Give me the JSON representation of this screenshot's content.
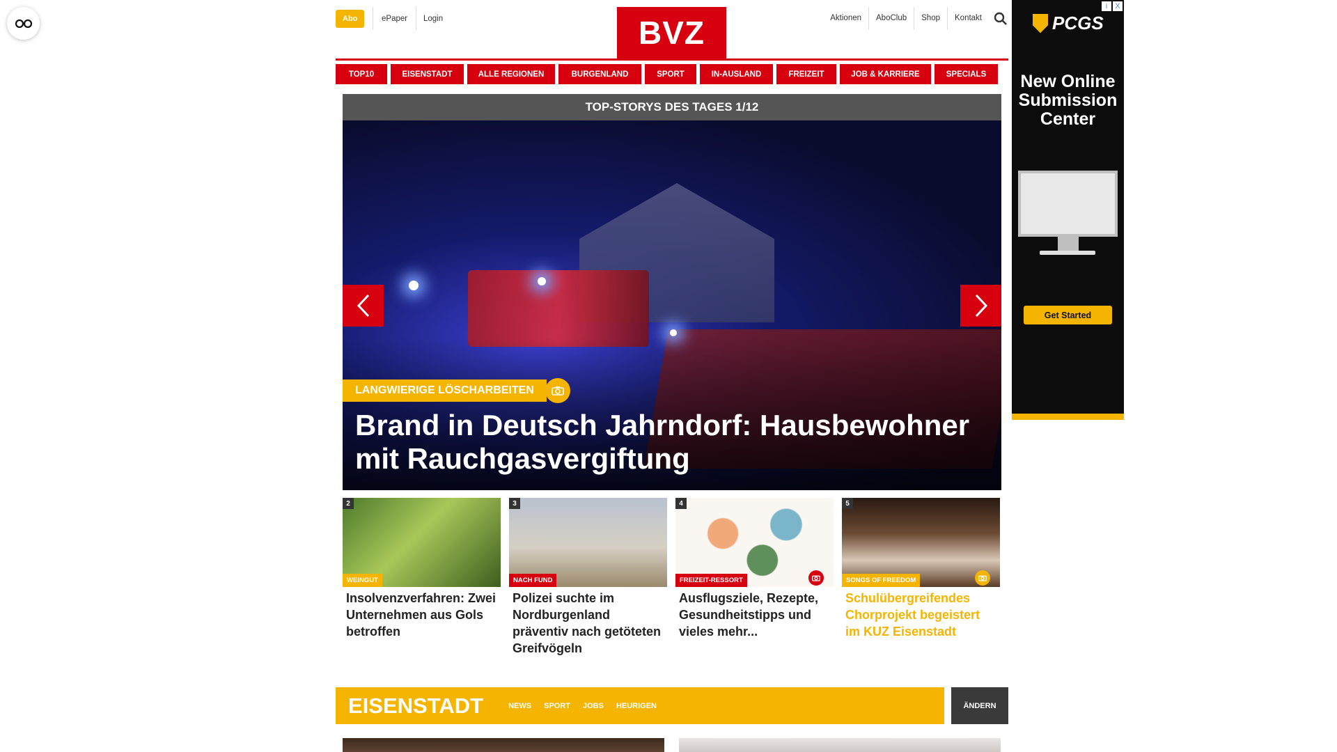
{
  "header": {
    "abo_label": "Abo",
    "epaper_label": "ePaper",
    "login_label": "Login",
    "logo_text": "BVZ",
    "right_links": [
      "Aktionen",
      "AboClub",
      "Shop",
      "Kontakt"
    ]
  },
  "nav": {
    "items": [
      "TOP10",
      "EISENSTADT",
      "ALLE REGIONEN",
      "BURGENLAND",
      "SPORT",
      "IN-AUSLAND",
      "FREIZEIT",
      "JOB & KARRIERE",
      "SPECIALS"
    ]
  },
  "hero": {
    "header": "TOP-STORYS DES TAGES 1/12",
    "kicker": "LANGWIERIGE LÖSCHARBEITEN",
    "title": "Brand in Deutsch Jahrndorf: Hausbewohner mit Rauchgasvergiftung"
  },
  "cards": [
    {
      "num": "2",
      "kicker": "WEINGUT",
      "title": "Insolvenzverfahren: Zwei Unternehmen aus Gols betroffen"
    },
    {
      "num": "3",
      "kicker": "NACH FUND",
      "title": "Polizei suchte im Nordburgenland präventiv nach getöteten Greifvögeln"
    },
    {
      "num": "4",
      "kicker": "FREIZEIT-RESSORT",
      "title": "Ausflugsziele, Rezepte, Gesundheitstipps und vieles mehr..."
    },
    {
      "num": "5",
      "kicker": "SONGS OF FREEDOM",
      "title": "Schulübergreifendes Chorprojekt begeistert im KUZ Eisenstadt"
    }
  ],
  "region": {
    "title": "EISENSTADT",
    "links": [
      "NEWS",
      "SPORT",
      "JOBS",
      "HEURIGEN"
    ],
    "change_label": "ÄNDERN"
  },
  "ad": {
    "brand": "PCGS",
    "headline": "New Online Submission Center",
    "button": "Get Started",
    "close_icons": [
      "i",
      "X"
    ]
  },
  "colors": {
    "brand_red": "#d7000f",
    "accent_yellow": "#f5b400",
    "dark_bar": "#555555"
  }
}
